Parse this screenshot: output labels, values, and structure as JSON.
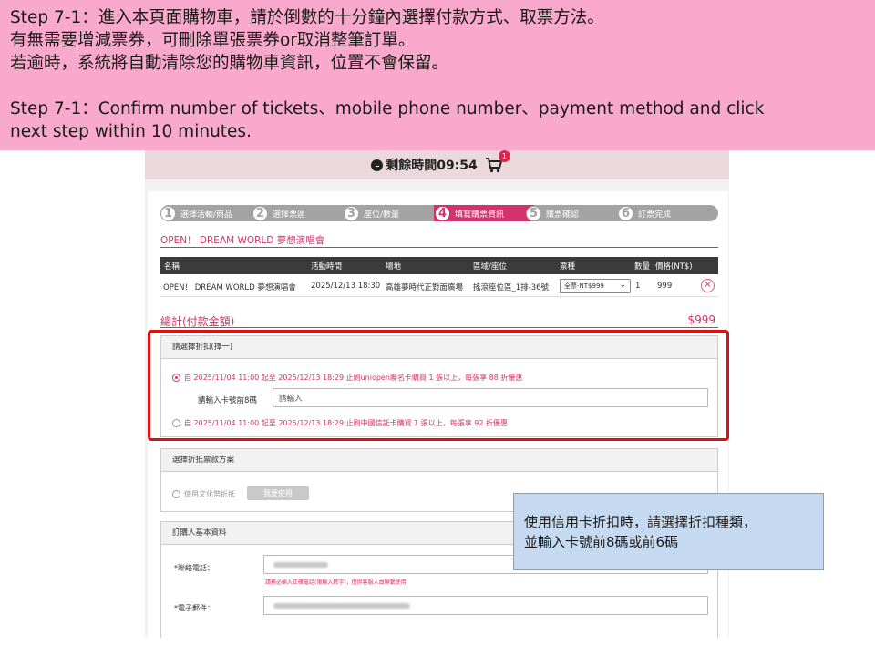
{
  "banner": {
    "lines": [
      "Step 7-1：進入本頁面購物車，請於倒數的十分鐘內選擇付款方式、取票方法。",
      "有無需要增減票券，可刪除單張票券or取消整筆訂單。",
      "若逾時，系統將自動清除您的購物車資訊，位置不會保留。",
      "",
      "Step 7-1：Confirm  number of tickets、mobile phone number、payment method and click",
      "next step within 10 minutes."
    ]
  },
  "timer": {
    "label": "剩餘時間09:54",
    "cart_count": "1"
  },
  "steps": [
    {
      "num": "1",
      "label": "選擇活動/商品"
    },
    {
      "num": "2",
      "label": "選擇票區"
    },
    {
      "num": "3",
      "label": "座位/數量"
    },
    {
      "num": "4",
      "label": "填寫購票資訊"
    },
    {
      "num": "5",
      "label": "購票確認"
    },
    {
      "num": "6",
      "label": "訂票完成"
    }
  ],
  "event_title": "OPEN！ DREAM WORLD 夢想演唱會",
  "table": {
    "headers": [
      "名稱",
      "活動時間",
      "場地",
      "區域/座位",
      "票種",
      "數量",
      "價格(NT$)"
    ],
    "row": {
      "name": "OPEN！ DREAM WORLD 夢想演唱會",
      "time": "2025/12/13 18:30",
      "venue": "高雄夢時代正對面廣場",
      "seat": "搖滾座位區_1排-36號",
      "ticket_type": "全票-NT$999",
      "qty": "1",
      "price": "999"
    }
  },
  "total": {
    "label": "總計(付款金額)",
    "value": "$999"
  },
  "discount": {
    "title": "請選擇折扣(擇一)",
    "option1": "自 2025/11/04 11:00 起至 2025/12/13 18:29 止刷uniopen聯名卡購買 1 張以上，每張享 88 折優惠",
    "card_label": "請輸入卡號前8碼",
    "card_placeholder": "請輸入",
    "option2": "自 2025/11/04 11:00 起至 2025/12/13 18:29 止刷中國信託卡購買 1 張以上，每張享 92 折優惠"
  },
  "voucher": {
    "title": "選擇折抵票款方案",
    "option": "使用文化幣折抵",
    "button": "我要使用"
  },
  "buyer": {
    "title": "訂購人基本資料",
    "phone_label": "*聯絡電話：",
    "phone_hint": "請務必輸入正確電話(限輸入數字)，僅供客服人員聯繫使用",
    "email_label": "*電子郵件："
  },
  "callout": {
    "line1": "使用信用卡折扣時，請選擇折扣種類，",
    "line2": "並輸入卡號前8碼或前6碼"
  },
  "colors": {
    "banner": "#f8a9cc",
    "accent": "#d4326c",
    "highlight_box": "#dd1111",
    "callout": "#c5d9f1"
  }
}
